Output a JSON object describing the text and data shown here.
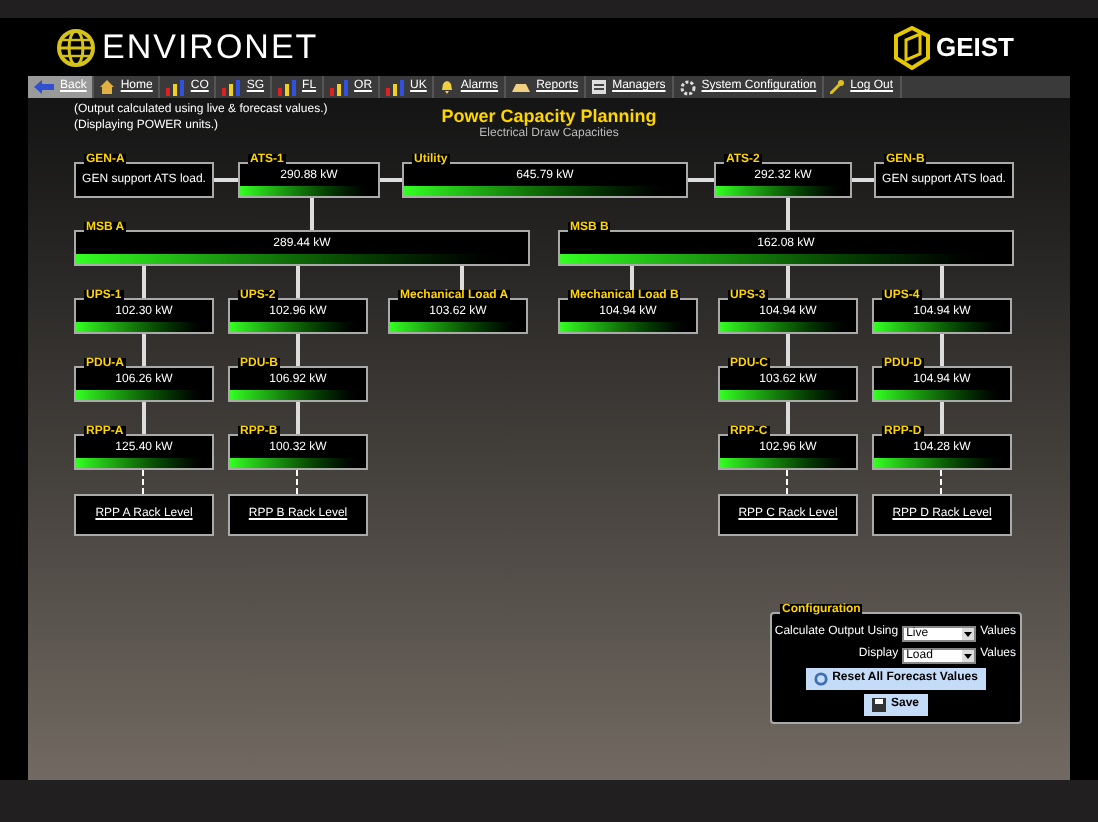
{
  "header": {
    "brand": "ENVIRONET",
    "vendor": "GEIST"
  },
  "nav": [
    {
      "label": "Back",
      "kind": "back",
      "selected": true
    },
    {
      "label": "Home",
      "kind": "home",
      "selected": false
    },
    {
      "label": "CO",
      "kind": "site",
      "selected": false
    },
    {
      "label": "SG",
      "kind": "site",
      "selected": false
    },
    {
      "label": "FL",
      "kind": "site",
      "selected": false
    },
    {
      "label": "OR",
      "kind": "site",
      "selected": false
    },
    {
      "label": "UK",
      "kind": "site",
      "selected": false
    },
    {
      "label": "Alarms",
      "kind": "alarms",
      "selected": false
    },
    {
      "label": "Reports",
      "kind": "reports",
      "selected": false
    },
    {
      "label": "Managers",
      "kind": "managers",
      "selected": false
    },
    {
      "label": "System Configuration",
      "kind": "settings",
      "selected": false
    },
    {
      "label": "Log Out",
      "kind": "logout",
      "selected": false
    }
  ],
  "notes": [
    "(Output calculated using live & forecast values.)",
    "(Displaying POWER units.)"
  ],
  "title": "Power Capacity Planning",
  "subtitle": "Electrical Draw Capacities",
  "nodes": [
    {
      "kind": "text",
      "title": "GEN-A",
      "text": "GEN support ATS load."
    },
    {
      "kind": "meter",
      "title": "ATS-1",
      "reading": "290.88 kW",
      "level": 1
    },
    {
      "kind": "meter",
      "title": "Utility",
      "reading": "645.79 kW",
      "level": 1
    },
    {
      "kind": "meter",
      "title": "ATS-2",
      "reading": "292.32 kW",
      "level": 1
    },
    {
      "kind": "text",
      "title": "GEN-B",
      "text": "GEN support ATS load."
    },
    {
      "kind": "meter",
      "title": "MSB A",
      "reading": "289.44 kW",
      "level": 1
    },
    {
      "kind": "meter",
      "title": "MSB B",
      "reading": "162.08 kW",
      "level": 1
    },
    {
      "kind": "meter",
      "title": "UPS-1",
      "reading": "102.30 kW",
      "level": 1
    },
    {
      "kind": "meter",
      "title": "UPS-2",
      "reading": "102.96 kW",
      "level": 1
    },
    {
      "kind": "meter",
      "title": "Mechanical Load A",
      "reading": "103.62 kW",
      "level": 1
    },
    {
      "kind": "meter",
      "title": "Mechanical Load B",
      "reading": "104.94 kW",
      "level": 1
    },
    {
      "kind": "meter",
      "title": "UPS-3",
      "reading": "104.94 kW",
      "level": 1
    },
    {
      "kind": "meter",
      "title": "UPS-4",
      "reading": "104.94 kW",
      "level": 1
    },
    {
      "kind": "meter",
      "title": "PDU-A",
      "reading": "106.26 kW",
      "level": 1
    },
    {
      "kind": "meter",
      "title": "PDU-B",
      "reading": "106.92 kW",
      "level": 1
    },
    {
      "kind": "meter",
      "title": "PDU-C",
      "reading": "103.62 kW",
      "level": 1
    },
    {
      "kind": "meter",
      "title": "PDU-D",
      "reading": "104.94 kW",
      "level": 1
    },
    {
      "kind": "meter",
      "title": "RPP-A",
      "reading": "125.40 kW",
      "level": 1
    },
    {
      "kind": "meter",
      "title": "RPP-B",
      "reading": "100.32 kW",
      "level": 1
    },
    {
      "kind": "meter",
      "title": "RPP-C",
      "reading": "102.96 kW",
      "level": 1
    },
    {
      "kind": "meter",
      "title": "RPP-D",
      "reading": "104.28 kW",
      "level": 1
    },
    {
      "kind": "link",
      "label": "RPP A Rack Level"
    },
    {
      "kind": "link",
      "label": "RPP B Rack Level"
    },
    {
      "kind": "link",
      "label": "RPP C Rack Level"
    },
    {
      "kind": "link",
      "label": "RPP D Rack Level"
    }
  ],
  "config": {
    "title": "Configuration",
    "rows": [
      {
        "label": "Calculate Output Using",
        "value": "Live",
        "suffix": "Values"
      },
      {
        "label": "Display",
        "value": "Load",
        "suffix": "Values"
      }
    ],
    "buttons": [
      {
        "label": "Reset All Forecast Values",
        "kind": "reset"
      },
      {
        "label": "Save",
        "kind": "save"
      }
    ]
  }
}
